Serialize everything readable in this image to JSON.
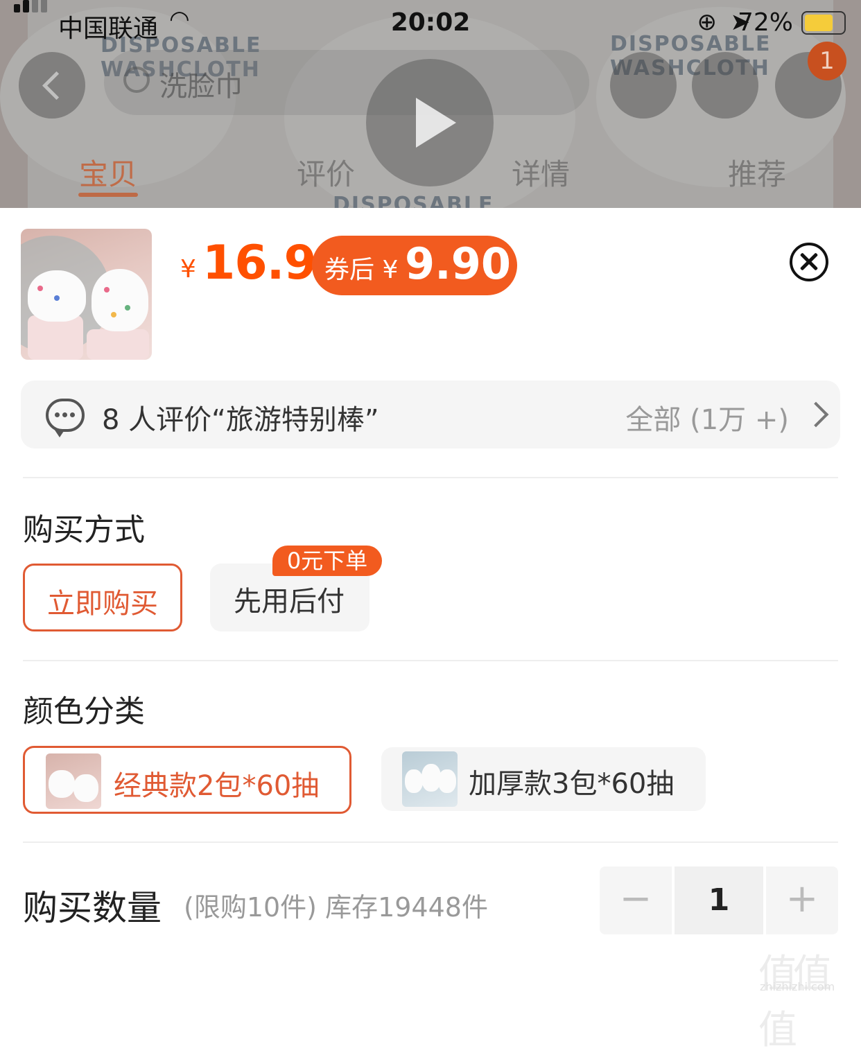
{
  "status_bar": {
    "carrier": "中国联通",
    "time": "20:02",
    "battery_percent": "72%",
    "battery_color": "#f5cc3a"
  },
  "background_page": {
    "search_placeholder": "洗脸巾",
    "cart_badge": "1",
    "tabs": [
      {
        "label": "宝贝",
        "active": true
      },
      {
        "label": "评价",
        "active": false
      },
      {
        "label": "详情",
        "active": false
      },
      {
        "label": "推荐",
        "active": false
      }
    ]
  },
  "product": {
    "currency": "¥",
    "price": "16.9",
    "coupon_label": "券后 ¥",
    "coupon_price": "9.90",
    "accent_color": "#ff5000"
  },
  "review_summary": {
    "text": "8 人评价“旅游特别棒”",
    "all_label": "全部 (1万 +)"
  },
  "purchase_method": {
    "title": "购买方式",
    "options": [
      {
        "label": "立即购买",
        "selected": true
      },
      {
        "label": "先用后付",
        "selected": false,
        "tag": "0元下单"
      }
    ]
  },
  "color_category": {
    "title": "颜色分类",
    "options": [
      {
        "label": "经典款2包*60抽",
        "selected": true,
        "icon": "product-thumb-pink"
      },
      {
        "label": "加厚款3包*60抽",
        "selected": false,
        "icon": "product-thumb-blue"
      }
    ]
  },
  "quantity": {
    "title": "购买数量",
    "info": "(限购10件) 库存19448件",
    "value": "1",
    "minus": "−",
    "plus": "+"
  },
  "watermark": {
    "glyphs": "值值值",
    "url": "zhizhizhi.com"
  }
}
